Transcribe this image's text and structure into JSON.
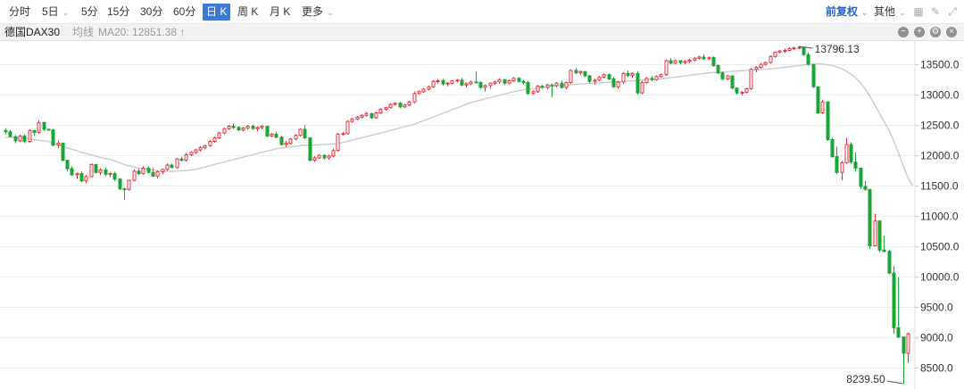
{
  "toolbar": {
    "periods": [
      {
        "label": "分时",
        "caret": false,
        "active": false
      },
      {
        "label": "5日",
        "caret": true,
        "active": false
      },
      {
        "label": "5分",
        "caret": false,
        "active": false
      },
      {
        "label": "15分",
        "caret": false,
        "active": false
      },
      {
        "label": "30分",
        "caret": false,
        "active": false
      },
      {
        "label": "60分",
        "caret": false,
        "active": false
      },
      {
        "label": "日 K",
        "caret": false,
        "active": true
      },
      {
        "label": "周 K",
        "caret": false,
        "active": false
      },
      {
        "label": "月 K",
        "caret": false,
        "active": false
      },
      {
        "label": "更多",
        "caret": true,
        "active": false
      }
    ],
    "adjust": "前复权",
    "other": "其他",
    "caret": "⌄",
    "icons": [
      "grid-icon",
      "draw-icon",
      "fullscreen-icon"
    ]
  },
  "info": {
    "name": "德国DAX30",
    "ma_label": "均线",
    "ma20": "MA20: 12851.38 ↑"
  },
  "chart_data": {
    "type": "candlestick",
    "instrument": "德国DAX30",
    "period": "日 K",
    "y_ticks": [
      8500,
      9000,
      9500,
      10000,
      10500,
      11000,
      11500,
      12000,
      12500,
      13000,
      13500
    ],
    "y_tick_labels": [
      "8500.0",
      "9000.0",
      "9500.0",
      "10000.0",
      "10500.0",
      "11000.0",
      "11500.0",
      "12000.0",
      "12500.0",
      "13000.0",
      "13500.0"
    ],
    "y_range": [
      8239.5,
      13796.13
    ],
    "annotations": {
      "high": "13796.13",
      "low": "8239.50"
    },
    "colors": {
      "up": "#e8323b",
      "down": "#1aa634",
      "ma": "#c8c8c8",
      "grid": "#ececec"
    },
    "candles": [
      [
        12410,
        12450,
        12360,
        12390
      ],
      [
        12390,
        12420,
        12300,
        12310
      ],
      [
        12310,
        12330,
        12200,
        12240
      ],
      [
        12240,
        12340,
        12220,
        12320
      ],
      [
        12320,
        12340,
        12200,
        12230
      ],
      [
        12230,
        12430,
        12210,
        12410
      ],
      [
        12410,
        12420,
        12320,
        12380
      ],
      [
        12380,
        12580,
        12360,
        12540
      ],
      [
        12540,
        12560,
        12400,
        12430
      ],
      [
        12430,
        12440,
        12410,
        12420
      ],
      [
        12420,
        12440,
        12150,
        12170
      ],
      [
        12170,
        12250,
        12120,
        12200
      ],
      [
        12200,
        12210,
        11900,
        11920
      ],
      [
        11920,
        11930,
        11740,
        11780
      ],
      [
        11780,
        11820,
        11660,
        11680
      ],
      [
        11680,
        11720,
        11620,
        11700
      ],
      [
        11700,
        11740,
        11560,
        11580
      ],
      [
        11580,
        11680,
        11540,
        11650
      ],
      [
        11650,
        11870,
        11640,
        11850
      ],
      [
        11850,
        11860,
        11700,
        11720
      ],
      [
        11720,
        11790,
        11680,
        11760
      ],
      [
        11760,
        11800,
        11660,
        11690
      ],
      [
        11690,
        11720,
        11640,
        11700
      ],
      [
        11700,
        11730,
        11580,
        11610
      ],
      [
        11610,
        11620,
        11430,
        11450
      ],
      [
        11450,
        11470,
        11270,
        11440
      ],
      [
        11440,
        11600,
        11420,
        11590
      ],
      [
        11590,
        11770,
        11570,
        11740
      ],
      [
        11740,
        11780,
        11680,
        11700
      ],
      [
        11700,
        11820,
        11680,
        11790
      ],
      [
        11790,
        11820,
        11700,
        11720
      ],
      [
        11720,
        11800,
        11650,
        11660
      ],
      [
        11660,
        11750,
        11620,
        11730
      ],
      [
        11730,
        11780,
        11690,
        11770
      ],
      [
        11770,
        11870,
        11750,
        11840
      ],
      [
        11840,
        11860,
        11790,
        11800
      ],
      [
        11800,
        11960,
        11780,
        11940
      ],
      [
        11940,
        11980,
        11900,
        11920
      ],
      [
        11920,
        12040,
        11900,
        12010
      ],
      [
        12010,
        12070,
        11990,
        12050
      ],
      [
        12050,
        12110,
        12020,
        12090
      ],
      [
        12090,
        12150,
        12060,
        12130
      ],
      [
        12130,
        12180,
        12100,
        12160
      ],
      [
        12160,
        12250,
        12140,
        12230
      ],
      [
        12230,
        12310,
        12210,
        12290
      ],
      [
        12290,
        12390,
        12270,
        12370
      ],
      [
        12370,
        12460,
        12350,
        12440
      ],
      [
        12440,
        12500,
        12420,
        12480
      ],
      [
        12480,
        12520,
        12430,
        12460
      ],
      [
        12460,
        12480,
        12400,
        12420
      ],
      [
        12420,
        12470,
        12400,
        12450
      ],
      [
        12450,
        12500,
        12420,
        12480
      ],
      [
        12480,
        12510,
        12420,
        12440
      ],
      [
        12440,
        12480,
        12400,
        12460
      ],
      [
        12460,
        12500,
        12430,
        12480
      ],
      [
        12480,
        12490,
        12300,
        12320
      ],
      [
        12320,
        12370,
        12300,
        12350
      ],
      [
        12350,
        12390,
        12280,
        12300
      ],
      [
        12300,
        12320,
        12160,
        12180
      ],
      [
        12180,
        12240,
        12140,
        12200
      ],
      [
        12200,
        12290,
        12180,
        12270
      ],
      [
        12270,
        12350,
        12250,
        12330
      ],
      [
        12330,
        12450,
        12310,
        12430
      ],
      [
        12430,
        12500,
        12270,
        12290
      ],
      [
        12290,
        12300,
        11900,
        11920
      ],
      [
        11920,
        11990,
        11890,
        11960
      ],
      [
        11960,
        12020,
        11940,
        12000
      ],
      [
        12000,
        12020,
        11930,
        11960
      ],
      [
        11960,
        12010,
        11930,
        11990
      ],
      [
        11990,
        12110,
        11970,
        12080
      ],
      [
        12080,
        12370,
        12060,
        12350
      ],
      [
        12350,
        12390,
        12330,
        12360
      ],
      [
        12360,
        12580,
        12340,
        12560
      ],
      [
        12560,
        12620,
        12540,
        12600
      ],
      [
        12600,
        12650,
        12580,
        12630
      ],
      [
        12630,
        12680,
        12610,
        12660
      ],
      [
        12660,
        12720,
        12640,
        12690
      ],
      [
        12690,
        12700,
        12600,
        12620
      ],
      [
        12620,
        12720,
        12600,
        12700
      ],
      [
        12700,
        12780,
        12680,
        12760
      ],
      [
        12760,
        12800,
        12740,
        12790
      ],
      [
        12790,
        12860,
        12770,
        12840
      ],
      [
        12840,
        12880,
        12820,
        12860
      ],
      [
        12860,
        12880,
        12780,
        12800
      ],
      [
        12800,
        12850,
        12780,
        12830
      ],
      [
        12830,
        12900,
        12810,
        12880
      ],
      [
        12880,
        13050,
        12860,
        13020
      ],
      [
        13020,
        13070,
        13000,
        13050
      ],
      [
        13050,
        13110,
        13030,
        13090
      ],
      [
        13090,
        13150,
        13070,
        13130
      ],
      [
        13130,
        13240,
        13110,
        13220
      ],
      [
        13220,
        13260,
        13190,
        13230
      ],
      [
        13230,
        13260,
        13150,
        13180
      ],
      [
        13180,
        13210,
        13140,
        13190
      ],
      [
        13190,
        13240,
        13170,
        13230
      ],
      [
        13230,
        13260,
        13200,
        13240
      ],
      [
        13240,
        13280,
        13140,
        13160
      ],
      [
        13160,
        13200,
        13120,
        13180
      ],
      [
        13180,
        13230,
        13160,
        13210
      ],
      [
        13210,
        13380,
        13190,
        13200
      ],
      [
        13200,
        13220,
        13100,
        13120
      ],
      [
        13120,
        13170,
        13050,
        13150
      ],
      [
        13150,
        13200,
        13100,
        13190
      ],
      [
        13190,
        13230,
        13160,
        13210
      ],
      [
        13210,
        13270,
        13180,
        13250
      ],
      [
        13250,
        13260,
        13160,
        13190
      ],
      [
        13190,
        13250,
        13170,
        13230
      ],
      [
        13230,
        13290,
        13210,
        13270
      ],
      [
        13270,
        13290,
        13200,
        13220
      ],
      [
        13220,
        13240,
        13170,
        13200
      ],
      [
        13200,
        13230,
        13000,
        13020
      ],
      [
        13020,
        13070,
        13000,
        13050
      ],
      [
        13050,
        13160,
        13030,
        13140
      ],
      [
        13140,
        13160,
        13100,
        13120
      ],
      [
        13120,
        13180,
        13090,
        13160
      ],
      [
        13160,
        13190,
        12960,
        13150
      ],
      [
        13150,
        13210,
        13120,
        13190
      ],
      [
        13190,
        13230,
        13100,
        13120
      ],
      [
        13120,
        13220,
        13090,
        13200
      ],
      [
        13200,
        13420,
        13180,
        13400
      ],
      [
        13400,
        13440,
        13340,
        13360
      ],
      [
        13360,
        13400,
        13320,
        13380
      ],
      [
        13380,
        13390,
        13290,
        13310
      ],
      [
        13310,
        13330,
        13190,
        13220
      ],
      [
        13220,
        13260,
        13170,
        13240
      ],
      [
        13240,
        13310,
        13220,
        13290
      ],
      [
        13290,
        13350,
        13270,
        13330
      ],
      [
        13330,
        13350,
        13240,
        13260
      ],
      [
        13260,
        13290,
        13110,
        13130
      ],
      [
        13130,
        13230,
        13100,
        13210
      ],
      [
        13210,
        13370,
        13180,
        13350
      ],
      [
        13350,
        13400,
        13290,
        13320
      ],
      [
        13320,
        13370,
        13280,
        13350
      ],
      [
        13350,
        13390,
        13000,
        13030
      ],
      [
        13030,
        13230,
        13010,
        13200
      ],
      [
        13200,
        13290,
        13180,
        13270
      ],
      [
        13270,
        13310,
        13220,
        13250
      ],
      [
        13250,
        13320,
        13230,
        13300
      ],
      [
        13300,
        13350,
        13280,
        13330
      ],
      [
        13330,
        13580,
        13310,
        13560
      ],
      [
        13560,
        13600,
        13500,
        13520
      ],
      [
        13520,
        13580,
        13500,
        13560
      ],
      [
        13560,
        13560,
        13500,
        13530
      ],
      [
        13530,
        13570,
        13500,
        13550
      ],
      [
        13550,
        13590,
        13520,
        13570
      ],
      [
        13570,
        13620,
        13550,
        13600
      ],
      [
        13600,
        13640,
        13580,
        13620
      ],
      [
        13620,
        13660,
        13580,
        13590
      ],
      [
        13590,
        13630,
        13570,
        13610
      ],
      [
        13610,
        13630,
        13460,
        13480
      ],
      [
        13480,
        13500,
        13340,
        13360
      ],
      [
        13360,
        13380,
        13240,
        13260
      ],
      [
        13260,
        13330,
        13240,
        13310
      ],
      [
        13310,
        13320,
        13090,
        13110
      ],
      [
        13110,
        13120,
        13000,
        13030
      ],
      [
        13030,
        13060,
        12990,
        13040
      ],
      [
        13040,
        13120,
        13020,
        13100
      ],
      [
        13100,
        13440,
        13080,
        13420
      ],
      [
        13420,
        13470,
        13370,
        13450
      ],
      [
        13450,
        13520,
        13430,
        13500
      ],
      [
        13500,
        13550,
        13480,
        13530
      ],
      [
        13530,
        13650,
        13510,
        13630
      ],
      [
        13630,
        13710,
        13610,
        13700
      ],
      [
        13700,
        13740,
        13680,
        13720
      ],
      [
        13720,
        13760,
        13690,
        13730
      ],
      [
        13730,
        13780,
        13710,
        13760
      ],
      [
        13760,
        13790,
        13740,
        13770
      ],
      [
        13770,
        13796,
        13750,
        13780
      ],
      [
        13780,
        13790,
        13640,
        13660
      ],
      [
        13660,
        13700,
        13480,
        13500
      ],
      [
        13500,
        13510,
        13110,
        13130
      ],
      [
        13130,
        13140,
        12680,
        12700
      ],
      [
        12700,
        12920,
        12680,
        12880
      ],
      [
        12880,
        12890,
        12240,
        12260
      ],
      [
        12260,
        12290,
        11960,
        11980
      ],
      [
        11980,
        12140,
        11690,
        11720
      ],
      [
        11720,
        11910,
        11590,
        11880
      ],
      [
        11880,
        12290,
        11860,
        12180
      ],
      [
        12180,
        12220,
        11860,
        11890
      ],
      [
        11890,
        12050,
        11730,
        11790
      ],
      [
        11790,
        11800,
        11450,
        11490
      ],
      [
        11490,
        11580,
        11420,
        11440
      ],
      [
        11440,
        10620,
        10460,
        10510
      ],
      [
        10510,
        11040,
        10500,
        10920
      ],
      [
        10920,
        10930,
        10410,
        10440
      ],
      [
        10440,
        10680,
        10400,
        10420
      ],
      [
        10420,
        10450,
        10040,
        10060
      ],
      [
        10060,
        10180,
        9060,
        9160
      ],
      [
        9160,
        9990,
        8990,
        9010
      ],
      [
        9010,
        9010,
        8240,
        8740
      ],
      [
        8740,
        9080,
        8580,
        9060
      ]
    ],
    "ma20": [
      12300,
      12300,
      12295,
      12290,
      12280,
      12275,
      12260,
      12250,
      12240,
      12230,
      12200,
      12180,
      12150,
      12120,
      12100,
      12080,
      12050,
      12030,
      12010,
      11990,
      11970,
      11950,
      11930,
      11910,
      11880,
      11850,
      11830,
      11810,
      11790,
      11780,
      11770,
      11760,
      11750,
      11745,
      11740,
      11735,
      11740,
      11745,
      11750,
      11760,
      11770,
      11790,
      11810,
      11830,
      11850,
      11870,
      11890,
      11910,
      11930,
      11950,
      11970,
      11990,
      12010,
      12030,
      12050,
      12070,
      12090,
      12110,
      12120,
      12130,
      12140,
      12150,
      12160,
      12170,
      12170,
      12170,
      12175,
      12180,
      12185,
      12190,
      12200,
      12210,
      12230,
      12250,
      12270,
      12290,
      12310,
      12330,
      12350,
      12370,
      12390,
      12410,
      12430,
      12450,
      12470,
      12490,
      12510,
      12540,
      12570,
      12600,
      12630,
      12660,
      12690,
      12720,
      12750,
      12780,
      12810,
      12840,
      12870,
      12890,
      12910,
      12930,
      12950,
      12970,
      12990,
      13010,
      13030,
      13050,
      13065,
      13080,
      13090,
      13100,
      13110,
      13120,
      13130,
      13140,
      13150,
      13155,
      13160,
      13165,
      13170,
      13175,
      13180,
      13185,
      13190,
      13195,
      13200,
      13205,
      13210,
      13215,
      13220,
      13225,
      13230,
      13235,
      13240,
      13245,
      13250,
      13255,
      13260,
      13270,
      13280,
      13290,
      13300,
      13310,
      13320,
      13330,
      13340,
      13350,
      13360,
      13365,
      13370,
      13375,
      13380,
      13385,
      13390,
      13395,
      13400,
      13405,
      13410,
      13415,
      13420,
      13425,
      13430,
      13440,
      13450,
      13460,
      13470,
      13480,
      13490,
      13500,
      13500,
      13510,
      13505,
      13495,
      13480,
      13460,
      13430,
      13390,
      13340,
      13280,
      13200,
      13100,
      12980,
      12840,
      12700,
      12560,
      12420,
      12250,
      12050,
      11840,
      11640,
      11500
    ]
  }
}
